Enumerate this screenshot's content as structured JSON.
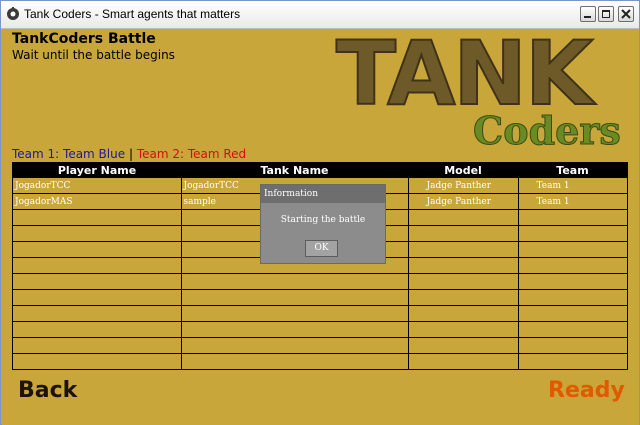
{
  "window": {
    "title": "Tank Coders - Smart agents that matters",
    "app_icon": "tank-coders-app-icon",
    "controls": [
      "minimize-icon",
      "maximize-icon",
      "close-icon"
    ]
  },
  "header": {
    "title": "TankCoders Battle",
    "subtitle": "Wait until the battle begins"
  },
  "logo": {
    "line1": "TANK",
    "line2": "Coders"
  },
  "teams": {
    "team1": "Team 1: Team Blue",
    "separator": "|",
    "team2": "Team 2: Team Red",
    "team1_color": "#1a1a9a",
    "team2_color": "#d01010"
  },
  "table": {
    "headers": [
      "Player Name",
      "Tank Name",
      "Model",
      "Team"
    ],
    "rows": [
      [
        "JogadorTCC",
        "JogadorTCC",
        "Jadge Panther",
        "Team 1"
      ],
      [
        "JogadorMAS",
        "sample",
        "Jadge Panther",
        "Team 1"
      ],
      [
        "",
        "",
        "",
        ""
      ],
      [
        "",
        "",
        "",
        ""
      ],
      [
        "",
        "",
        "",
        ""
      ],
      [
        "",
        "",
        "",
        ""
      ],
      [
        "",
        "",
        "",
        ""
      ],
      [
        "",
        "",
        "",
        ""
      ],
      [
        "",
        "",
        "",
        ""
      ],
      [
        "",
        "",
        "",
        ""
      ],
      [
        "",
        "",
        "",
        ""
      ],
      [
        "",
        "",
        "",
        ""
      ]
    ]
  },
  "footer": {
    "back_label": "Back",
    "ready_label": "Ready"
  },
  "dialog": {
    "title": "Information",
    "message": "Starting the battle",
    "ok_label": "OK"
  },
  "colors": {
    "background": "#c8a63a",
    "ready": "#e05a00",
    "back": "#1c140c"
  }
}
